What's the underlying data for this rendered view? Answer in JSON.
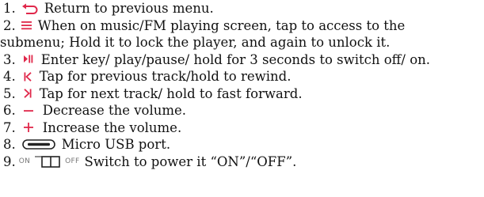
{
  "items": [
    {
      "num": "1.",
      "icon": "return-arrow-icon",
      "text": "Return to previous menu."
    },
    {
      "num": "2.",
      "icon": "menu-lines-icon",
      "text": "When on music/FM playing screen, tap to access to the",
      "continuation": "submenu; Hold it to lock the player, and again to unlock it."
    },
    {
      "num": "3.",
      "icon": "play-pause-icon",
      "text": "Enter key/ play/pause/ hold for 3 seconds to switch off/ on."
    },
    {
      "num": "4.",
      "icon": "previous-track-icon",
      "text": "Tap for previous track/hold to rewind."
    },
    {
      "num": "5.",
      "icon": "next-track-icon",
      "text": "Tap for next track/ hold to fast forward."
    },
    {
      "num": "6.",
      "icon": "minus-icon",
      "text": "Decrease the volume."
    },
    {
      "num": "7.",
      "icon": "plus-icon",
      "text": "Increase the volume."
    },
    {
      "num": "8.",
      "icon": "micro-usb-port-icon",
      "text": "Micro USB port."
    },
    {
      "num": "9.",
      "icon": "power-switch-icon",
      "switch_on": "ON",
      "switch_off": "OFF",
      "text": "Switch to power it “ON”/“OFF”."
    }
  ],
  "colors": {
    "icon_accent": "#e0284b",
    "text": "#111111"
  }
}
